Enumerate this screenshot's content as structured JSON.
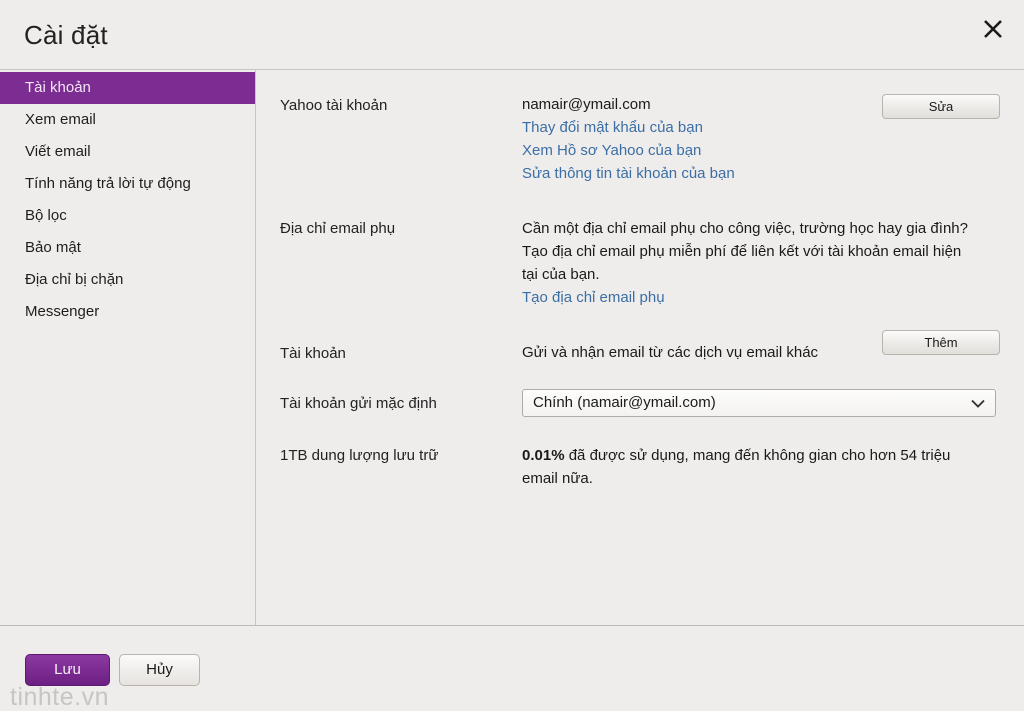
{
  "window": {
    "title": "Cài đặt",
    "close_icon": "close-icon"
  },
  "sidebar": {
    "items": [
      {
        "label": "Tài khoản",
        "selected": true
      },
      {
        "label": "Xem email",
        "selected": false
      },
      {
        "label": "Viết email",
        "selected": false
      },
      {
        "label": "Tính năng trả lời tự động",
        "selected": false
      },
      {
        "label": "Bộ lọc",
        "selected": false
      },
      {
        "label": "Bảo mật",
        "selected": false
      },
      {
        "label": "Địa chỉ bị chặn",
        "selected": false
      },
      {
        "label": "Messenger",
        "selected": false
      }
    ]
  },
  "main": {
    "yahoo_account": {
      "label": "Yahoo tài khoản",
      "email": "namair@ymail.com",
      "links": [
        "Thay đổi mật khẩu của bạn",
        "Xem Hồ sơ Yahoo của bạn",
        "Sửa thông tin tài khoản của bạn"
      ],
      "edit_button": "Sửa"
    },
    "alt_email": {
      "label": "Địa chỉ email phụ",
      "description": "Cần một địa chỉ email phụ cho công việc, trường học hay gia đình? Tạo địa chỉ email phụ miễn phí để liên kết với tài khoản email hiện tại của bạn.",
      "link": "Tạo địa chỉ email phụ"
    },
    "mailboxes": {
      "label": "Tài khoản",
      "description": "Gửi và nhận email từ các dịch vụ email khác",
      "add_button": "Thêm"
    },
    "default_sender": {
      "label": "Tài khoản gửi mặc định",
      "selected_option": "Chính (namair@ymail.com)",
      "dropdown_icon": "chevron-down-icon"
    },
    "storage": {
      "label": "1TB dung lượng lưu trữ",
      "percent": "0.01%",
      "description": " đã được sử dụng, mang đến không gian cho hơn 54 triệu email nữa."
    }
  },
  "footer": {
    "save_label": "Lưu",
    "cancel_label": "Hủy",
    "watermark": "tinhte.vn"
  },
  "colors": {
    "accent_purple": "#7b2d91",
    "link_blue": "#3b6ea5",
    "background": "#efedeb"
  }
}
